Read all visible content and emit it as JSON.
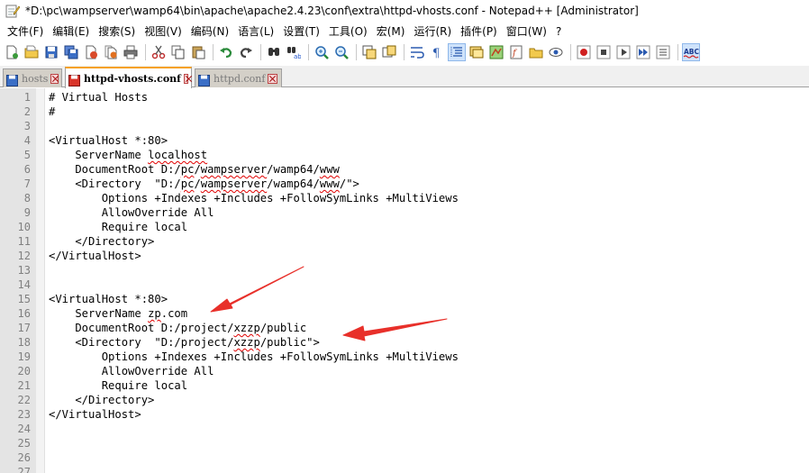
{
  "window": {
    "title": "*D:\\pc\\wampserver\\wamp64\\bin\\apache\\apache2.4.23\\conf\\extra\\httpd-vhosts.conf - Notepad++ [Administrator]",
    "app_icon": "notepad-icon"
  },
  "menu": {
    "items": [
      "文件(F)",
      "编辑(E)",
      "搜索(S)",
      "视图(V)",
      "编码(N)",
      "语言(L)",
      "设置(T)",
      "工具(O)",
      "宏(M)",
      "运行(R)",
      "插件(P)",
      "窗口(W)",
      "?"
    ]
  },
  "toolbar": {
    "icons": [
      "new-file-icon",
      "open-file-icon",
      "save-icon",
      "save-all-icon",
      "close-icon",
      "close-all-icon",
      "print-icon",
      "cut-icon",
      "copy-icon",
      "paste-icon",
      "undo-icon",
      "redo-icon",
      "find-icon",
      "replace-icon",
      "zoom-in-icon",
      "zoom-out-icon",
      "sync-vertical-icon",
      "sync-horizontal-icon",
      "word-wrap-icon",
      "show-all-chars-icon",
      "indent-guide-icon",
      "user-language-icon",
      "document-map-icon",
      "function-list-icon",
      "folder-workspace-icon",
      "monitor-icon",
      "record-macro-icon",
      "stop-macro-icon",
      "play-macro-icon",
      "play-multiple-icon",
      "save-macro-icon",
      "spell-check-icon"
    ],
    "spell_check_label": "ABC"
  },
  "tabs": [
    {
      "label": "hosts",
      "active": false,
      "saved": true
    },
    {
      "label": "httpd-vhosts.conf",
      "active": true,
      "saved": false
    },
    {
      "label": "httpd.conf",
      "active": false,
      "saved": true
    }
  ],
  "editor": {
    "lines": [
      {
        "n": "1",
        "text": "# Virtual Hosts"
      },
      {
        "n": "2",
        "text": "#"
      },
      {
        "n": "3",
        "text": ""
      },
      {
        "n": "4",
        "text": "<VirtualHost *:80>"
      },
      {
        "n": "5",
        "text": "    ServerName localhost"
      },
      {
        "n": "6",
        "text": "    DocumentRoot D:/pc/wampserver/wamp64/www"
      },
      {
        "n": "7",
        "text": "    <Directory  \"D:/pc/wampserver/wamp64/www/\">"
      },
      {
        "n": "8",
        "text": "        Options +Indexes +Includes +FollowSymLinks +MultiViews"
      },
      {
        "n": "9",
        "text": "        AllowOverride All"
      },
      {
        "n": "10",
        "text": "        Require local"
      },
      {
        "n": "11",
        "text": "    </Directory>"
      },
      {
        "n": "12",
        "text": "</VirtualHost>"
      },
      {
        "n": "13",
        "text": ""
      },
      {
        "n": "14",
        "text": ""
      },
      {
        "n": "15",
        "text": "<VirtualHost *:80>"
      },
      {
        "n": "16",
        "text": "    ServerName zp.com"
      },
      {
        "n": "17",
        "text": "    DocumentRoot D:/project/xzzp/public"
      },
      {
        "n": "18",
        "text": "    <Directory  \"D:/project/xzzp/public\">"
      },
      {
        "n": "19",
        "text": "        Options +Indexes +Includes +FollowSymLinks +MultiViews"
      },
      {
        "n": "20",
        "text": "        AllowOverride All"
      },
      {
        "n": "21",
        "text": "        Require local"
      },
      {
        "n": "22",
        "text": "    </Directory>"
      },
      {
        "n": "23",
        "text": "</VirtualHost>"
      },
      {
        "n": "24",
        "text": ""
      },
      {
        "n": "25",
        "text": ""
      },
      {
        "n": "26",
        "text": ""
      },
      {
        "n": "27",
        "text": ""
      }
    ],
    "spellcheck_words": [
      "localhost",
      "pc",
      "wampserver",
      "www",
      "zp",
      "xzzp"
    ]
  },
  "colors": {
    "annotation_arrow": "#e8302a",
    "active_tab_accent": "#f6a11e",
    "gutter": "#e4e4e4"
  }
}
